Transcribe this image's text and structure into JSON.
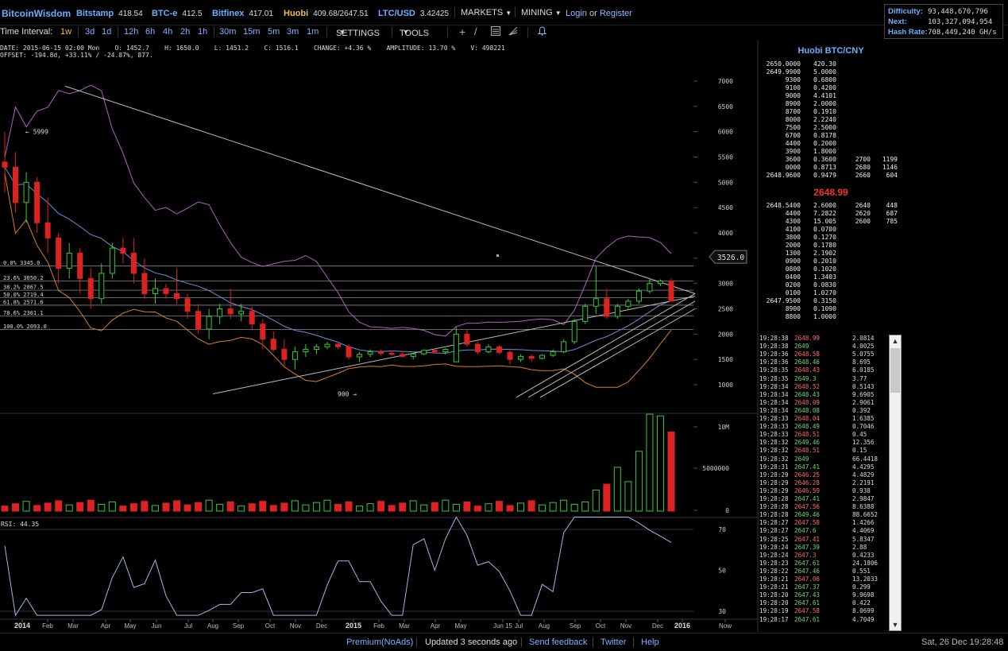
{
  "brand": "BitcoinWisdom",
  "exchanges": [
    {
      "name": "Bitstamp",
      "price": "418.54",
      "color": "#6ab0ff"
    },
    {
      "name": "BTC-e",
      "price": "412.5",
      "color": "#6ab0ff"
    },
    {
      "name": "Bitfinex",
      "price": "417.01",
      "color": "#6ab0ff"
    },
    {
      "name": "Huobi",
      "price": "409.68/2647.51",
      "color": "#f0c040"
    },
    {
      "name": "LTC/USD",
      "price": "3.42425",
      "color": "#6ab0ff"
    }
  ],
  "menus": {
    "markets": "MARKETS",
    "mining": "MINING"
  },
  "login": {
    "login": "Login",
    "or": "or",
    "register": "Register"
  },
  "network": {
    "difficulty_label": "Difficulty:",
    "difficulty": "93,448,670,796",
    "next_label": "Next:",
    "next": "103,327,094,954",
    "hashrate_label": "Hash Rate:",
    "hashrate": "708,449,240 GH/s"
  },
  "toolbar": {
    "time_interval_label": "Time Interval:",
    "intervals": [
      "1w",
      "3d",
      "1d",
      "12h",
      "6h",
      "4h",
      "2h",
      "1h",
      "30m",
      "15m",
      "5m",
      "3m",
      "1m"
    ],
    "active_interval": "1w",
    "settings": "SETTINGS",
    "tools": "TOOLS"
  },
  "info": {
    "line1": "DATE: 2015-06-15 02:00 Mon    O: 1452.7    H: 1650.0    L: 1451.2    C: 1516.1    CHANGE: +4.36 %    AMPLITUDE: 13.70 %    V: 498221",
    "line2": "OFFSET: -194.8d, +33.11% / -24.87%, 877."
  },
  "chart_data": {
    "type": "candlestick",
    "price_axis": {
      "ticks": [
        7000,
        6500,
        6000,
        5500,
        5000,
        4500,
        4000,
        3500,
        3000,
        2500,
        2000,
        1500,
        1000
      ],
      "range": [
        500,
        7300
      ]
    },
    "current_price_label": "3526.0",
    "annotations": {
      "high": "← 5999",
      "low": "900 →"
    },
    "fib_levels": [
      {
        "label": "0.0% 3345.0",
        "value": 3345.0
      },
      {
        "label": "23.6% 3050.2",
        "value": 3050.2
      },
      {
        "label": "38.2% 2867.5",
        "value": 2867.5
      },
      {
        "label": "50.0% 2719.4",
        "value": 2719.4
      },
      {
        "label": "61.8% 2571.6",
        "value": 2571.6
      },
      {
        "label": "78.6% 2361.1",
        "value": 2361.1
      },
      {
        "label": "100.0% 2093.0",
        "value": 2093.0
      }
    ],
    "x_labels": [
      "2014",
      "Feb",
      "Mar",
      "Apr",
      "May",
      "Jun",
      "Jul",
      "Aug",
      "Sep",
      "Oct",
      "Nov",
      "Dec",
      "2015",
      "Feb",
      "Mar",
      "Apr",
      "May",
      "Jun 15",
      "Jul",
      "Aug",
      "Sep",
      "Oct",
      "Nov",
      "Dec",
      "2016",
      "Now"
    ],
    "candles": [
      [
        5400,
        5999,
        4800,
        5300
      ],
      [
        5300,
        5600,
        4400,
        4600
      ],
      [
        4600,
        5200,
        4200,
        5000
      ],
      [
        5000,
        5100,
        4000,
        4200
      ],
      [
        4200,
        4700,
        3600,
        3900
      ],
      [
        3900,
        4000,
        3000,
        3300
      ],
      [
        3300,
        3800,
        3100,
        3600
      ],
      [
        3600,
        3700,
        2800,
        3100
      ],
      [
        3100,
        3300,
        2500,
        2700
      ],
      [
        2700,
        3400,
        2600,
        3200
      ],
      [
        3200,
        3800,
        3100,
        3700
      ],
      [
        3700,
        3900,
        3400,
        3600
      ],
      [
        3600,
        3900,
        3000,
        3200
      ],
      [
        3200,
        3500,
        2700,
        2800
      ],
      [
        2800,
        3100,
        2600,
        2900
      ],
      [
        2900,
        3000,
        2700,
        2800
      ],
      [
        2800,
        3300,
        2600,
        2700
      ],
      [
        2700,
        2800,
        2300,
        2450
      ],
      [
        2450,
        2600,
        2000,
        2100
      ],
      [
        2100,
        2500,
        1900,
        2350
      ],
      [
        2350,
        2600,
        2200,
        2500
      ],
      [
        2500,
        2900,
        2300,
        2400
      ],
      [
        2400,
        2600,
        2250,
        2450
      ],
      [
        2450,
        2550,
        2100,
        2200
      ],
      [
        2200,
        2300,
        1700,
        1900
      ],
      [
        1900,
        2050,
        1650,
        1700
      ],
      [
        1700,
        1900,
        1350,
        1500
      ],
      [
        1500,
        1750,
        1300,
        1650
      ],
      [
        1650,
        1800,
        1550,
        1700
      ],
      [
        1700,
        1800,
        1600,
        1750
      ],
      [
        1750,
        1850,
        1700,
        1800
      ],
      [
        1800,
        1850,
        1700,
        1750
      ],
      [
        1750,
        1800,
        1500,
        1550
      ],
      [
        1550,
        1650,
        1450,
        1600
      ],
      [
        1600,
        1700,
        1550,
        1650
      ],
      [
        1650,
        1700,
        1580,
        1620
      ],
      [
        1620,
        1680,
        1580,
        1600
      ],
      [
        1600,
        1640,
        1540,
        1560
      ],
      [
        1560,
        1620,
        1500,
        1610
      ],
      [
        1610,
        1700,
        1580,
        1680
      ],
      [
        1680,
        1720,
        1620,
        1650
      ],
      [
        1650,
        1720,
        1600,
        1700
      ],
      [
        1452.7,
        2150,
        1451.2,
        2000
      ],
      [
        2000,
        2100,
        1750,
        1800
      ],
      [
        1800,
        1850,
        1600,
        1650
      ],
      [
        1650,
        1800,
        1620,
        1750
      ],
      [
        1750,
        1780,
        1600,
        1640
      ],
      [
        1640,
        1680,
        1400,
        1500
      ],
      [
        1500,
        1600,
        1450,
        1560
      ],
      [
        1560,
        1600,
        1450,
        1520
      ],
      [
        1520,
        1600,
        1500,
        1580
      ],
      [
        1580,
        1700,
        1550,
        1650
      ],
      [
        1650,
        1900,
        1620,
        1850
      ],
      [
        1850,
        2300,
        1800,
        2250
      ],
      [
        2250,
        2600,
        2200,
        2550
      ],
      [
        2550,
        3350,
        2400,
        2700
      ],
      [
        2700,
        2900,
        2300,
        2350
      ],
      [
        2350,
        2600,
        2300,
        2550
      ],
      [
        2550,
        2700,
        2500,
        2650
      ],
      [
        2650,
        2900,
        2600,
        2850
      ],
      [
        2850,
        3100,
        2800,
        3000
      ],
      [
        3000,
        3080,
        2950,
        3050
      ],
      [
        3050,
        3100,
        2700,
        2650
      ]
    ],
    "volume_axis": {
      "ticks": [
        "10M",
        "5000000",
        "0"
      ]
    },
    "rsi": {
      "label": "RSI: 44.35",
      "ticks": [
        70,
        50,
        30
      ]
    }
  },
  "orderbook": {
    "title": "Huobi BTC/CNY",
    "asks": [
      [
        "2650.0000",
        "420.30",
        "",
        ""
      ],
      [
        "2649.9900",
        "5.0000",
        "",
        ""
      ],
      [
        "9300",
        "0.6800",
        "",
        ""
      ],
      [
        "9100",
        "0.4200",
        "",
        ""
      ],
      [
        "9000",
        "4.4101",
        "",
        ""
      ],
      [
        "8900",
        "2.0000",
        "",
        ""
      ],
      [
        "8700",
        "0.1910",
        "",
        ""
      ],
      [
        "8000",
        "2.2240",
        "",
        ""
      ],
      [
        "7500",
        "2.5000",
        "",
        ""
      ],
      [
        "6700",
        "0.8178",
        "",
        ""
      ],
      [
        "4400",
        "0.2000",
        "",
        ""
      ],
      [
        "3900",
        "1.8000",
        "",
        ""
      ],
      [
        "3600",
        "0.3600",
        "2700",
        "1199"
      ],
      [
        "0000",
        "0.8713",
        "2680",
        "1146"
      ],
      [
        "2648.9600",
        "0.9479",
        "2660",
        "604"
      ]
    ],
    "last": "2648.99",
    "bids": [
      [
        "2648.5400",
        "2.6000",
        "2640",
        "448"
      ],
      [
        "4400",
        "7.2822",
        "2620",
        "687"
      ],
      [
        "4300",
        "15.005",
        "2600",
        "785"
      ],
      [
        "4100",
        "0.0700",
        "",
        ""
      ],
      [
        "3800",
        "0.1270",
        "",
        ""
      ],
      [
        "2000",
        "0.1780",
        "",
        ""
      ],
      [
        "1300",
        "2.1902",
        "",
        ""
      ],
      [
        "0900",
        "0.2010",
        "",
        ""
      ],
      [
        "0800",
        "0.1020",
        "",
        ""
      ],
      [
        "0400",
        "1.3403",
        "",
        ""
      ],
      [
        "0200",
        "0.0830",
        "",
        ""
      ],
      [
        "0100",
        "1.0270",
        "",
        ""
      ],
      [
        "2647.9500",
        "0.3150",
        "",
        ""
      ],
      [
        "8900",
        "0.1090",
        "",
        ""
      ],
      [
        "8800",
        "1.0000",
        "",
        ""
      ]
    ]
  },
  "trades": [
    [
      "19:28:38",
      "2648.99",
      "2.0814",
      "red"
    ],
    [
      "19:28:38",
      "2649",
      "4.0025",
      "green"
    ],
    [
      "19:28:36",
      "2648.58",
      "5.0755",
      "red"
    ],
    [
      "19:28:36",
      "2648.46",
      "8.695",
      "green"
    ],
    [
      "19:28:35",
      "2648.43",
      "6.0185",
      "red"
    ],
    [
      "19:28:35",
      "2649.3",
      "3.77",
      "green"
    ],
    [
      "19:28:34",
      "2648.52",
      "0.5143",
      "red"
    ],
    [
      "19:28:34",
      "2648.43",
      "9.6905",
      "green"
    ],
    [
      "19:28:34",
      "2648.09",
      "2.9061",
      "red"
    ],
    [
      "19:28:34",
      "2648.08",
      "0.392",
      "green"
    ],
    [
      "19:28:33",
      "2648.04",
      "1.6385",
      "red"
    ],
    [
      "19:28:33",
      "2648.49",
      "0.7046",
      "green"
    ],
    [
      "19:28:33",
      "2648.51",
      "0.45",
      "red"
    ],
    [
      "19:28:32",
      "2649.46",
      "12.356",
      "green"
    ],
    [
      "19:28:32",
      "2648.51",
      "0.15",
      "red"
    ],
    [
      "19:28:32",
      "2649",
      "66.4418",
      "green"
    ],
    [
      "19:28:31",
      "2647.41",
      "4.4295",
      "green"
    ],
    [
      "19:28:29",
      "2646.25",
      "4.4829",
      "red"
    ],
    [
      "19:28:29",
      "2646.28",
      "2.2191",
      "red"
    ],
    [
      "19:28:29",
      "2646.59",
      "0.938",
      "red"
    ],
    [
      "19:28:28",
      "2647.41",
      "2.9847",
      "green"
    ],
    [
      "19:28:28",
      "2647.56",
      "8.6388",
      "red"
    ],
    [
      "19:28:28",
      "2649.46",
      "88.6652",
      "green"
    ],
    [
      "19:28:27",
      "2647.58",
      "1.4266",
      "red"
    ],
    [
      "19:28:27",
      "2647.6",
      "4.4069",
      "green"
    ],
    [
      "19:28:25",
      "2647.41",
      "5.8347",
      "red"
    ],
    [
      "19:28:24",
      "2647.39",
      "2.88",
      "green"
    ],
    [
      "19:28:24",
      "2647.3",
      "0.4233",
      "red"
    ],
    [
      "19:28:23",
      "2647.61",
      "24.1806",
      "green"
    ],
    [
      "19:28:22",
      "2647.46",
      "0.551",
      "green"
    ],
    [
      "19:28:21",
      "2647.06",
      "13.2033",
      "red"
    ],
    [
      "19:28:21",
      "2647.37",
      "0.299",
      "green"
    ],
    [
      "19:28:20",
      "2647.43",
      "9.9698",
      "green"
    ],
    [
      "19:28:20",
      "2647.61",
      "0.422",
      "green"
    ],
    [
      "19:28:19",
      "2647.58",
      "8.0699",
      "red"
    ],
    [
      "19:28:17",
      "2647.61",
      "4.7049",
      "green"
    ]
  ],
  "status": {
    "premium": "Premium(NoAds)",
    "updated": "Updated 3 seconds ago",
    "feedback": "Send feedback",
    "twitter": "Twitter",
    "help": "Help",
    "datetime": "Sat, 26 Dec 19:28:48"
  },
  "colors": {
    "up": "#3c3",
    "down": "#d22",
    "link": "#7fb2ff",
    "gold": "#f0c040",
    "bg": "#000000"
  }
}
